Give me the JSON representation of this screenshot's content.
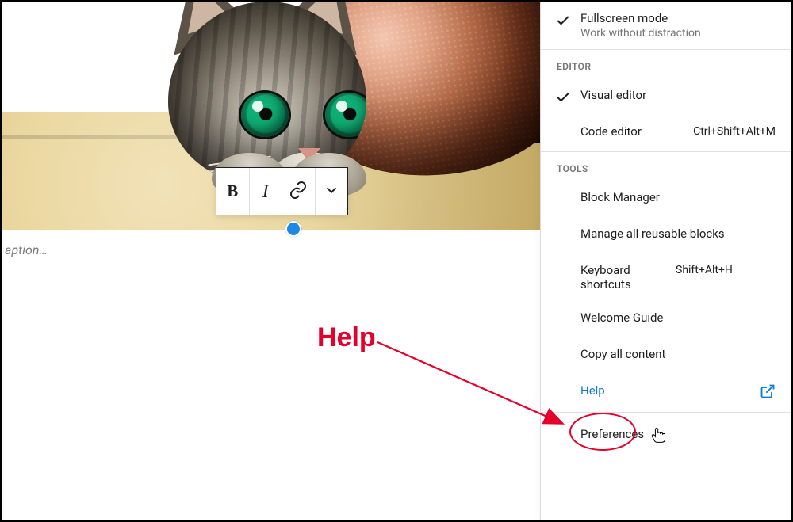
{
  "editor": {
    "caption_placeholder": "aption…"
  },
  "toolbar": {
    "bold": "B",
    "italic": "I"
  },
  "menu": {
    "view_items": {
      "fullscreen": {
        "label": "Fullscreen mode",
        "sub": "Work without distraction",
        "checked": true
      }
    },
    "editor_label": "EDITOR",
    "editor_items": {
      "visual": {
        "label": "Visual editor",
        "checked": true
      },
      "code": {
        "label": "Code editor",
        "shortcut": "Ctrl+Shift+Alt+M"
      }
    },
    "tools_label": "TOOLS",
    "tools_items": {
      "block_manager": {
        "label": "Block Manager"
      },
      "reusable_blocks": {
        "label": "Manage all reusable blocks"
      },
      "keyboard": {
        "label": "Keyboard shortcuts",
        "shortcut": "Shift+Alt+H"
      },
      "welcome": {
        "label": "Welcome Guide"
      },
      "copy_all": {
        "label": "Copy all content"
      },
      "help": {
        "label": "Help"
      }
    },
    "preferences": {
      "label": "Preferences"
    }
  },
  "annotation": {
    "label": "Help"
  }
}
